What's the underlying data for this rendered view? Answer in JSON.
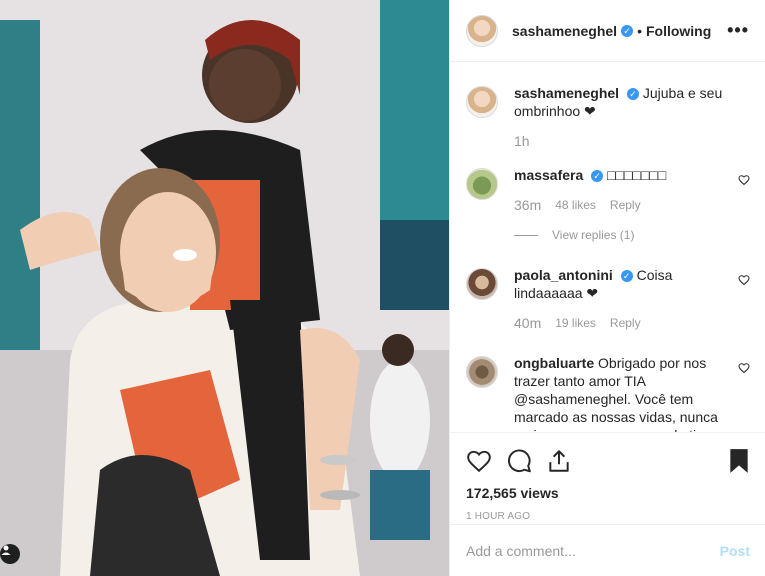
{
  "header": {
    "username": "sashameneghel",
    "separator": "•",
    "follow_state": "Following",
    "more_label": "•••"
  },
  "caption": {
    "username": "sashameneghel",
    "text": "Jujuba e seu ombrinhoo ❤",
    "time": "1h"
  },
  "comments": [
    {
      "username": "massafera",
      "verified": true,
      "text": "□□□□□□□",
      "time": "36m",
      "likes": "48 likes",
      "reply": "Reply",
      "view_replies": "View replies (1)"
    },
    {
      "username": "paola_antonini",
      "verified": true,
      "text": "Coisa lindaaaaaa ❤",
      "time": "40m",
      "likes": "19 likes",
      "reply": "Reply"
    },
    {
      "username": "ongbaluarte",
      "verified": false,
      "text": "Obrigado por nos trazer tanto amor TIA @sashameneghel. Você tem marcado as nossas vidas, nunca mais nos esqueceremos de ti"
    }
  ],
  "stats": {
    "views": "172,565 views",
    "posted": "1 HOUR AGO"
  },
  "add_comment": {
    "placeholder": "Add a comment...",
    "post_label": "Post"
  },
  "icons": {
    "like": "heart-icon",
    "comment": "comment-icon",
    "share": "share-icon",
    "save": "bookmark-icon",
    "tag": "user-tag-icon",
    "verified": "verified-badge-icon"
  }
}
